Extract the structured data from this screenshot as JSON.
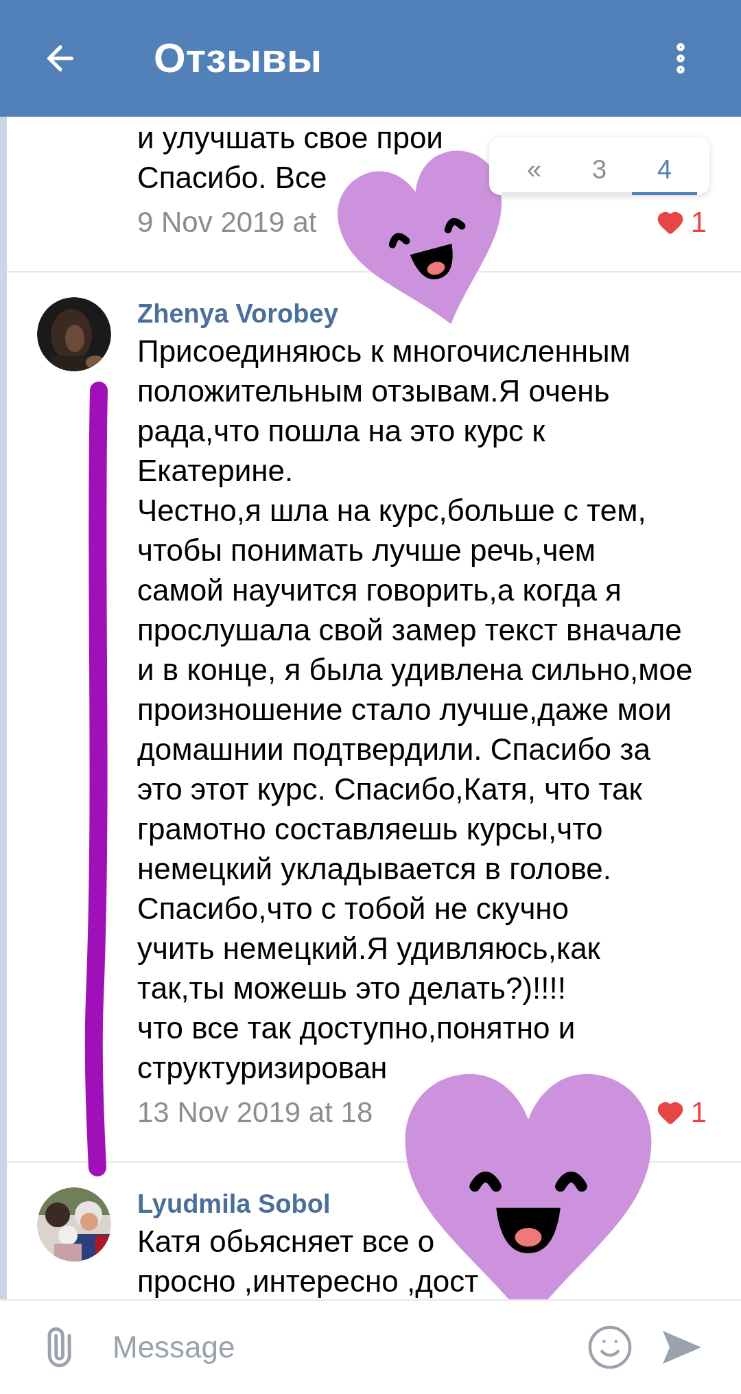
{
  "header": {
    "title": "Отзывы"
  },
  "pagination": [
    {
      "label": "«",
      "selected": false
    },
    {
      "label": "3",
      "selected": false
    },
    {
      "label": "4",
      "selected": true
    }
  ],
  "comments": [
    {
      "text": "и улучшать свое прои\nСпасибо. Все",
      "date": "9 Nov 2019 at",
      "likes": "1",
      "liked": true
    },
    {
      "author": "Zhenya Vorobey",
      "text": "Присоединяюсь к многочисленным\nположительным отзывам.Я очень\nрада,что пошла на это курс к\nЕкатерине.\nЧестно,я шла на курс,больше с тем,\nчтобы понимать лучше речь,чем\nсамой научится говорить,а когда я\nпрослушала свой замер текст вначале\nи в конце, я была удивлена сильно,мое\nпроизношение стало лучше,даже мои\nдомашнии подтвердили. Спасибо за\nэто этот курс. Спасибо,Катя, что так\nграмотно составляешь курсы,что\nнемецкий укладывается в голове.\nСпасибо,что с тобой не скучно\nучить немецкий.Я удивляюсь,как\nтак,ты можешь это делать?)!!!!\nчто все так доступно,понятно и\nструктуризирован",
      "date": "13 Nov 2019 at 18",
      "likes": "1",
      "liked": true
    },
    {
      "author": "Lyudmila Sobol",
      "text": "Катя обьясняет все о\nпросно ,интересно ,дост"
    }
  ],
  "composer": {
    "placeholder": "Message"
  }
}
